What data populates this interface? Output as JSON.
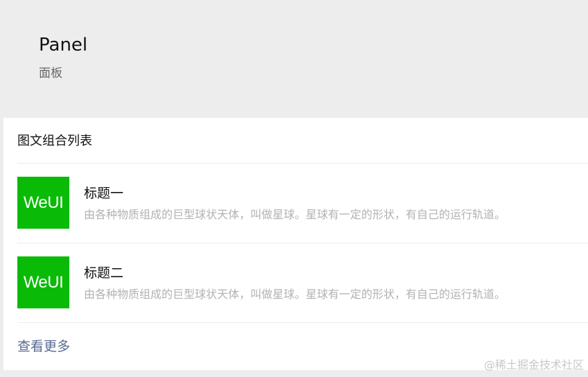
{
  "page": {
    "title": "Panel",
    "desc": "面板"
  },
  "panel": {
    "header": "图文组合列表",
    "items": [
      {
        "thumb_text": "WeUI",
        "title": "标题一",
        "desc": "由各种物质组成的巨型球状天体，叫做星球。星球有一定的形状，有自己的运行轨道。"
      },
      {
        "thumb_text": "WeUI",
        "title": "标题二",
        "desc": "由各种物质组成的巨型球状天体，叫做星球。星球有一定的形状，有自己的运行轨道。"
      }
    ],
    "more_label": "查看更多"
  },
  "watermark": "@稀土掘金技术社区",
  "colors": {
    "background": "#ededed",
    "panel": "#ffffff",
    "thumb": "#09bb07",
    "link": "#576b95",
    "desc": "#b2b2b2"
  }
}
